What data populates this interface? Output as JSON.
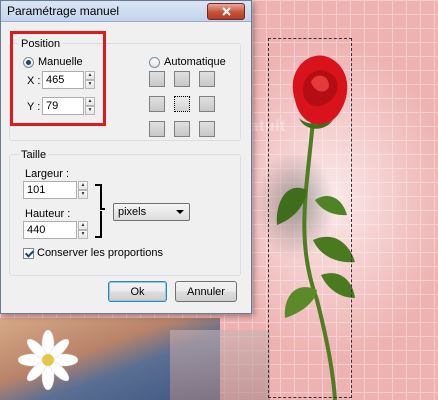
{
  "dialog": {
    "title": "Paramétrage manuel",
    "position": {
      "label": "Position",
      "manual_label": "Manuelle",
      "auto_label": "Automatique",
      "x_label": "X :",
      "x_value": "465",
      "y_label": "Y :",
      "y_value": "79",
      "selected_mode": "manual"
    },
    "size": {
      "label": "Taille",
      "width_label": "Largeur :",
      "width_value": "101",
      "height_label": "Hauteur :",
      "height_value": "440",
      "unit_selected": "pixels",
      "keep_proportions_label": "Conserver les proportions",
      "keep_proportions_checked": true
    },
    "buttons": {
      "ok": "Ok",
      "cancel": "Annuler"
    }
  },
  "canvas": {
    "watermark": "PhotoFiltreGratuit"
  },
  "colors": {
    "highlight": "#e0191c",
    "background_pink": "#f2c1c1",
    "rose_red": "#d9121b",
    "stem_green": "#4f7d22"
  }
}
